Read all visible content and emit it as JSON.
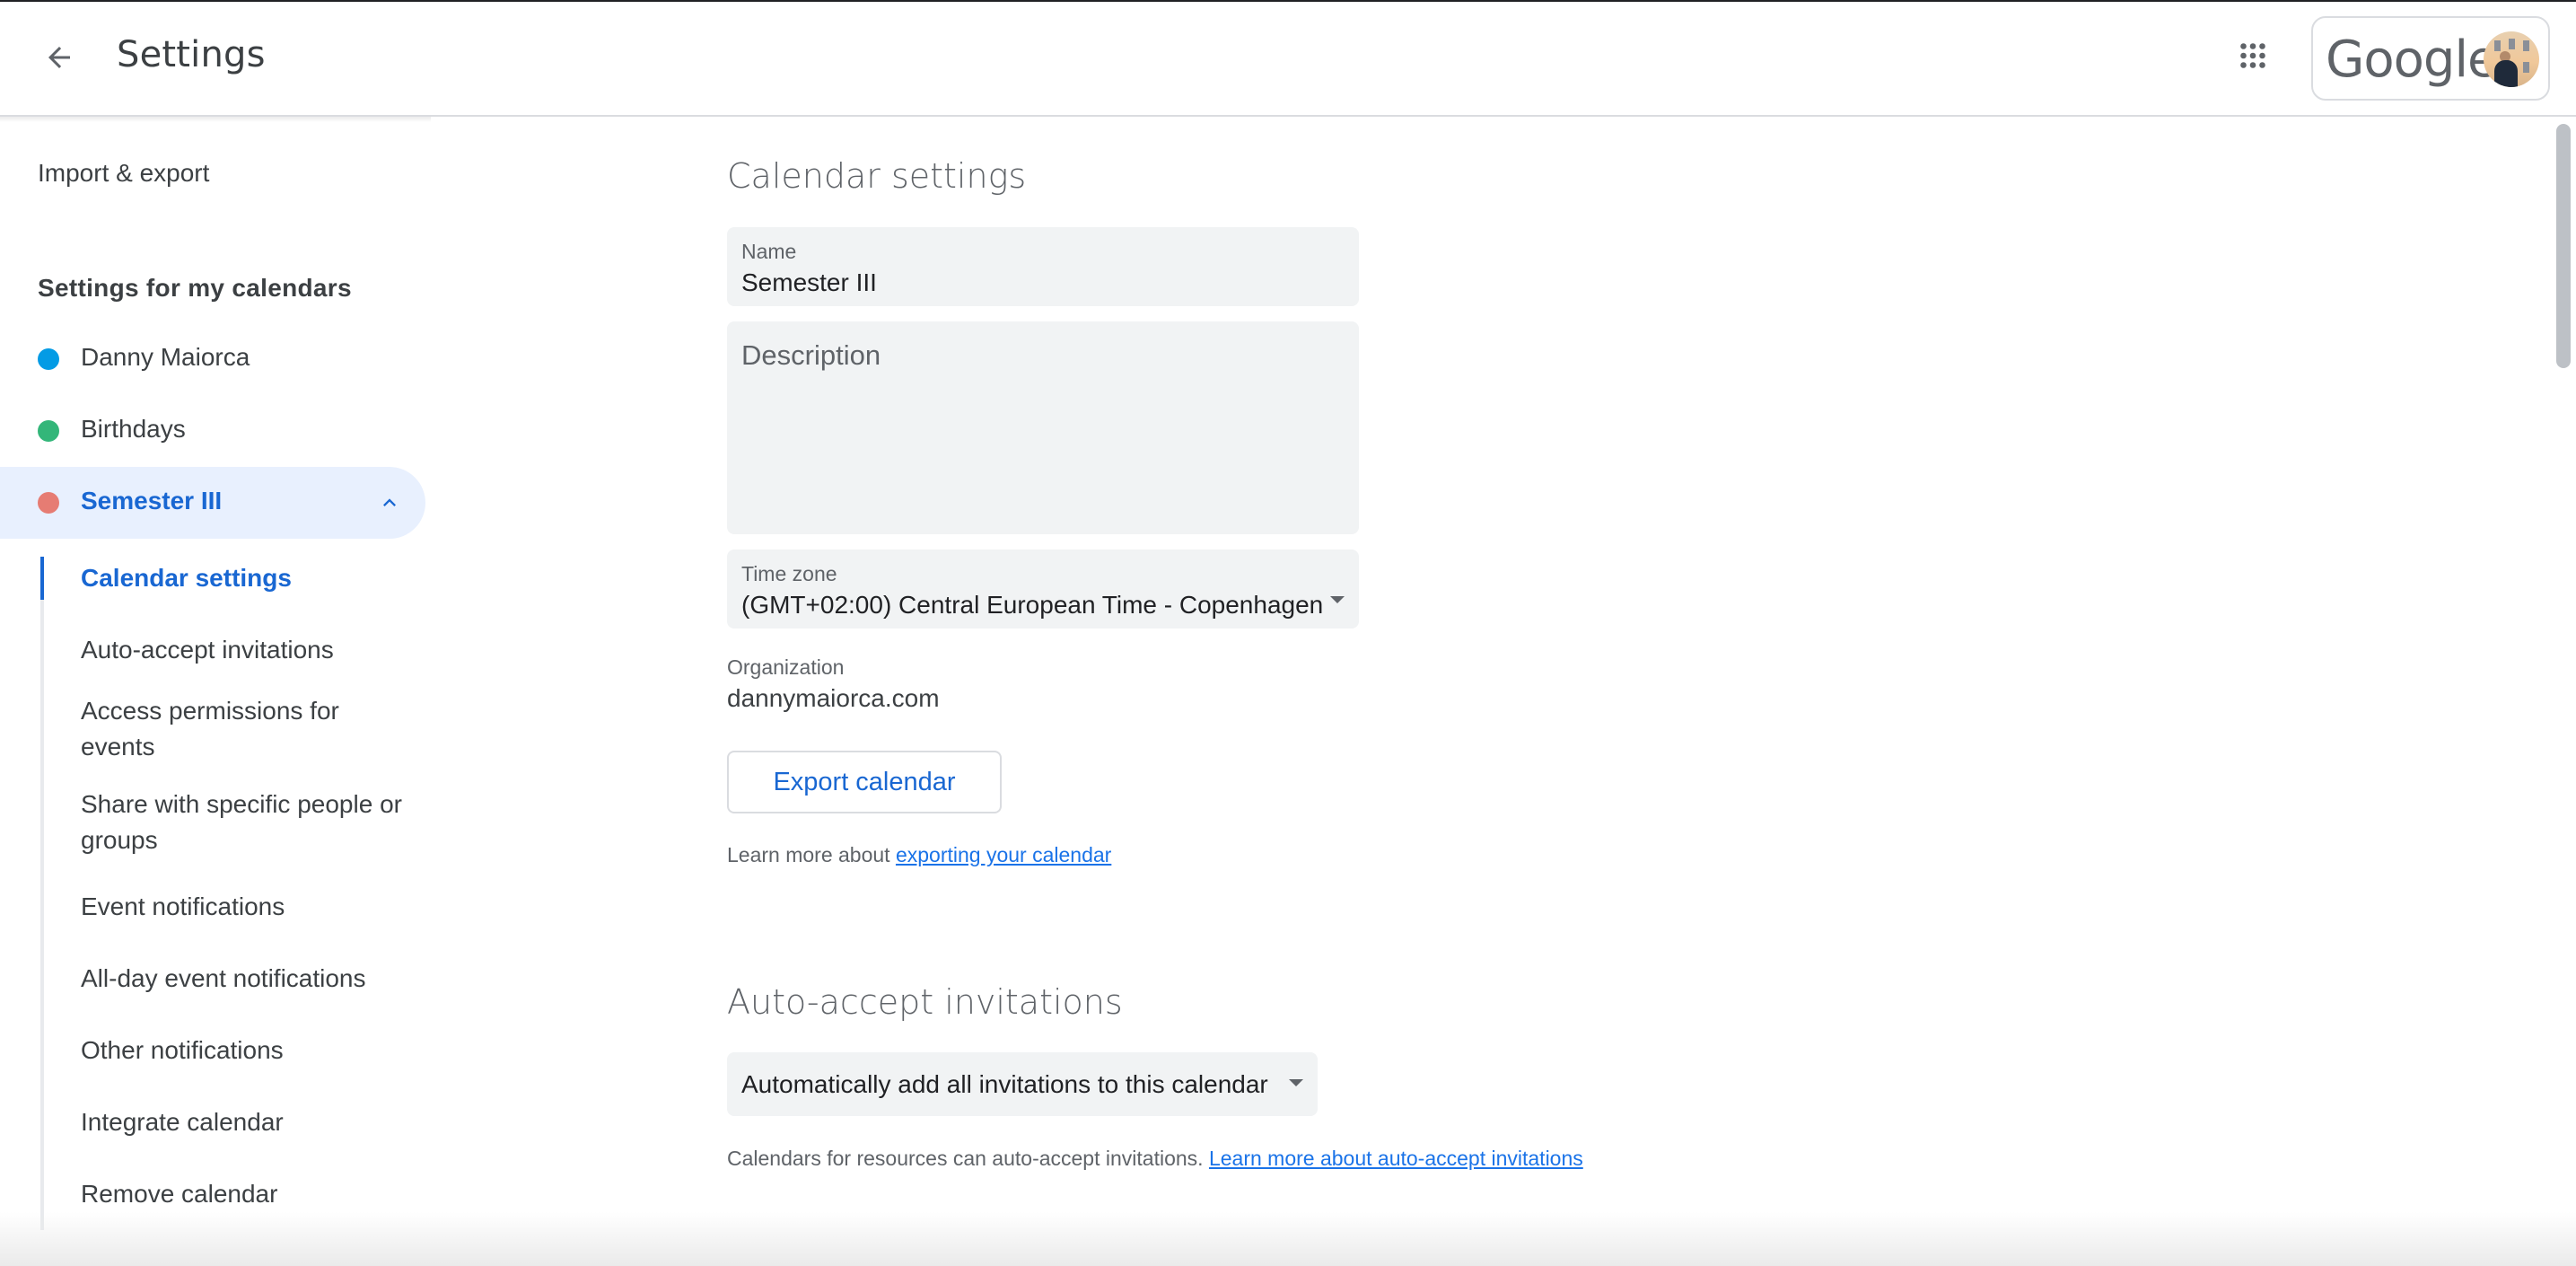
{
  "header": {
    "back_icon": "arrow-back-icon",
    "title": "Settings",
    "apps_icon": "apps-grid-icon",
    "brand": "Google",
    "avatar_icon": "account-avatar"
  },
  "sidebar": {
    "import_export": "Import & export",
    "my_calendars_heading": "Settings for my calendars",
    "calendars": [
      {
        "name": "Danny Maiorca",
        "color": "#039be5",
        "active": false
      },
      {
        "name": "Birthdays",
        "color": "#33b679",
        "active": false
      },
      {
        "name": "Semester III",
        "color": "#e67c73",
        "active": true,
        "expanded": true
      }
    ],
    "sub_items": [
      {
        "label": "Calendar settings",
        "active": true
      },
      {
        "label": "Auto-accept invitations",
        "active": false
      },
      {
        "label": "Access permissions for events",
        "active": false
      },
      {
        "label": "Share with specific people or groups",
        "active": false
      },
      {
        "label": "Event notifications",
        "active": false
      },
      {
        "label": "All-day event notifications",
        "active": false
      },
      {
        "label": "Other notifications",
        "active": false
      },
      {
        "label": "Integrate calendar",
        "active": false
      },
      {
        "label": "Remove calendar",
        "active": false
      }
    ]
  },
  "main": {
    "calendar_settings": {
      "title": "Calendar settings",
      "name_label": "Name",
      "name_value": "Semester III",
      "description_placeholder": "Description",
      "description_value": "",
      "timezone_label": "Time zone",
      "timezone_value": "(GMT+02:00) Central European Time - Copenhagen",
      "organization_label": "Organization",
      "organization_value": "dannymaiorca.com",
      "export_button": "Export calendar",
      "export_help_prefix": "Learn more about ",
      "export_help_link": "exporting your calendar"
    },
    "auto_accept": {
      "title": "Auto-accept invitations",
      "select_value": "Automatically add all invitations to this calendar",
      "help_prefix": "Calendars for resources can auto-accept invitations. ",
      "help_link": "Learn more about auto-accept invitations"
    }
  },
  "colors": {
    "accent": "#1967d2",
    "active_bg": "#e8f0fe",
    "field_bg": "#f1f3f4",
    "link": "#1a73e8"
  }
}
